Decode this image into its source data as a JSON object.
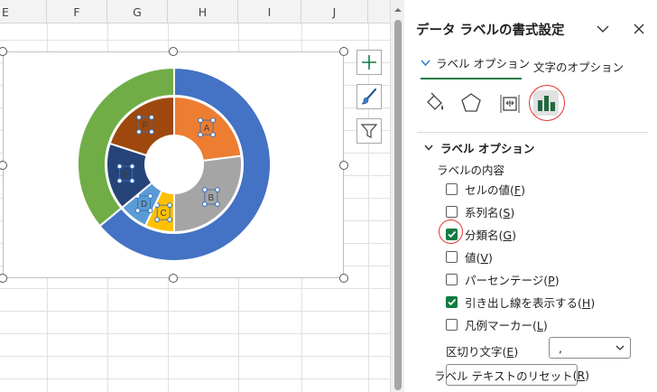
{
  "sheet": {
    "columns": [
      "E",
      "F",
      "G",
      "H",
      "I",
      "J"
    ]
  },
  "chart_data": {
    "type": "donut",
    "rings": [
      {
        "name": "outer",
        "slices": [
          {
            "color": "#4472c4",
            "value": 64.0
          },
          {
            "color": "#70ad47",
            "value": 36.0
          }
        ]
      },
      {
        "name": "inner",
        "slices": [
          {
            "label": "A",
            "color": "#ed7d31",
            "value": 23.0
          },
          {
            "label": "B",
            "color": "#a5a5a5",
            "value": 27.0
          },
          {
            "label": "C",
            "color": "#ffc000",
            "value": 7.0
          },
          {
            "label": "D",
            "color": "#5b9bd5",
            "value": 7.0
          },
          {
            "label": "E",
            "color": "#264478",
            "value": 16.0
          },
          {
            "label": "F",
            "color": "#9e480e",
            "value": 20.0
          }
        ]
      }
    ]
  },
  "pane": {
    "title": "データ ラベルの書式設定",
    "tabs": {
      "label_options": "ラベル オプション",
      "text_options": "文字のオプション"
    },
    "section_title": "ラベル オプション",
    "content_label": "ラベルの内容",
    "options": [
      {
        "label": "セルの値",
        "key": "F",
        "checked": false
      },
      {
        "label": "系列名",
        "key": "S",
        "checked": false
      },
      {
        "label": "分類名",
        "key": "G",
        "checked": true
      },
      {
        "label": "値",
        "key": "V",
        "checked": false
      },
      {
        "label": "パーセンテージ",
        "key": "P",
        "checked": false
      },
      {
        "label": "引き出し線を表示する",
        "key": "H",
        "checked": true
      },
      {
        "label": "凡例マーカー",
        "key": "L",
        "checked": false
      }
    ],
    "separator": {
      "label": "区切り文字",
      "key": "E",
      "value": ","
    },
    "reset": {
      "label": "ラベル テキストのリセット",
      "key": "R"
    }
  },
  "colors": {
    "accent": "#107c41",
    "highlight": "#e03030"
  }
}
